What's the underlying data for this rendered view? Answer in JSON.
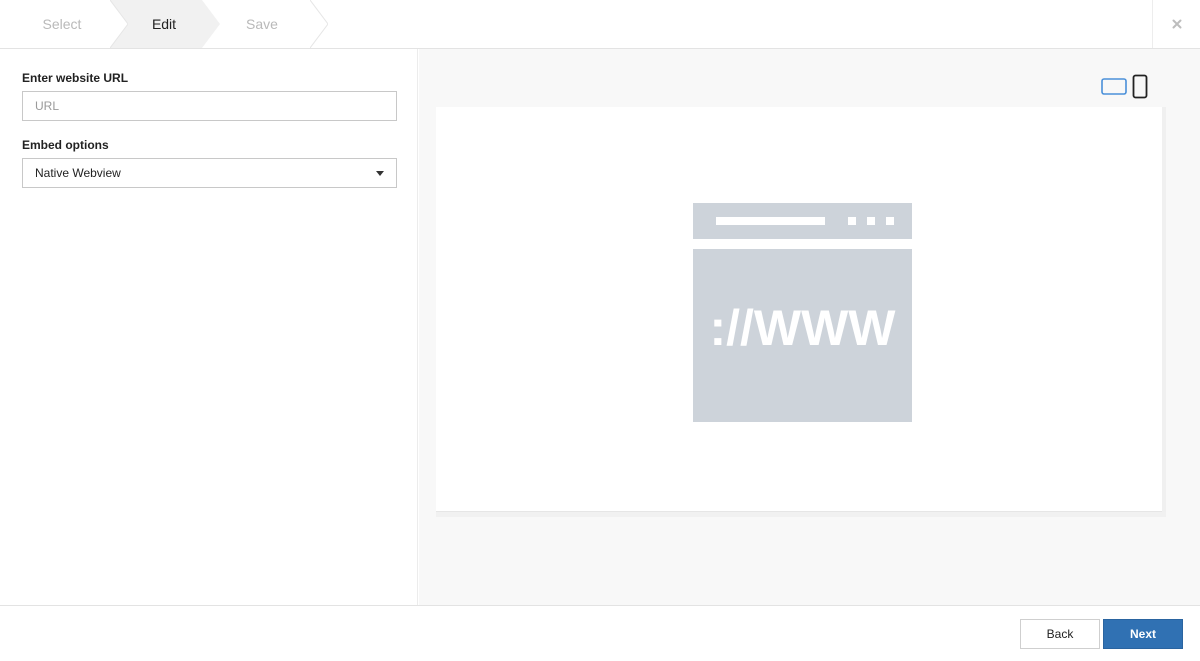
{
  "wizard": {
    "steps": [
      {
        "label": "Select",
        "state": "done"
      },
      {
        "label": "Edit",
        "state": "active"
      },
      {
        "label": "Save",
        "state": "upcoming"
      }
    ],
    "close_icon": "close-icon"
  },
  "form": {
    "url_label": "Enter website URL",
    "url_placeholder": "URL",
    "url_value": "",
    "embed_label": "Embed options",
    "embed_selected": "Native Webview"
  },
  "preview": {
    "device_toggle": [
      {
        "icon": "desktop-landscape-icon",
        "active": true
      },
      {
        "icon": "mobile-portrait-icon",
        "active": false
      }
    ],
    "illustration_icon": "www-placeholder-icon",
    "illustration_text": "://WWW"
  },
  "footer": {
    "back_label": "Back",
    "next_label": "Next"
  },
  "colors": {
    "accent": "#3071b3",
    "toggle_active": "#4a90d9",
    "illustration": "#cdd3da",
    "active_step_bg": "#f1f1f1"
  }
}
